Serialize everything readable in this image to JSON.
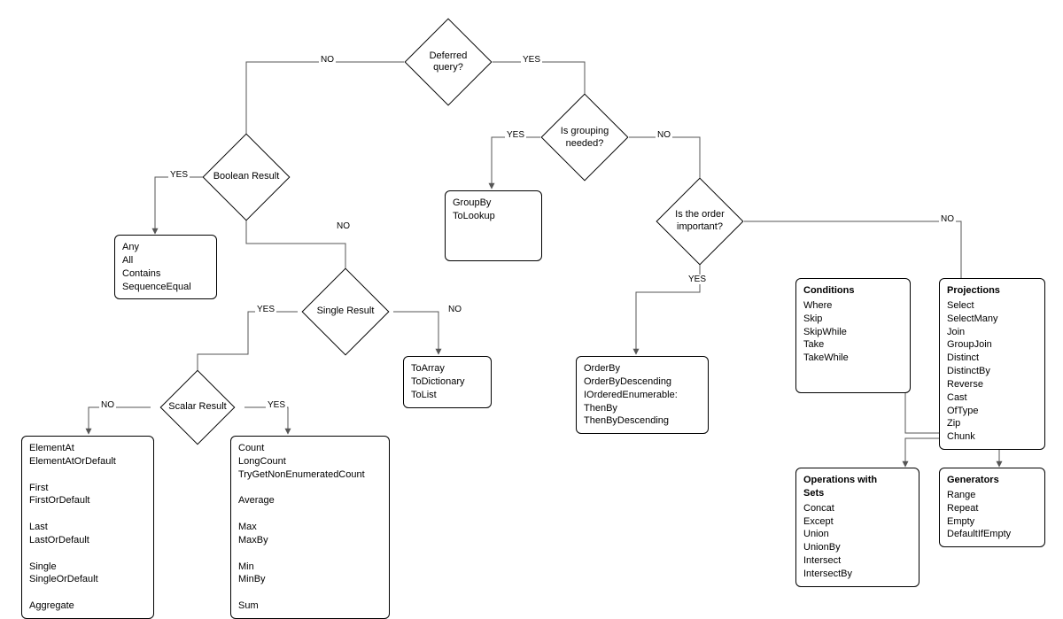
{
  "decisions": {
    "deferred": "Deferred\nquery?",
    "grouping": "Is grouping\nneeded?",
    "order": "Is the order\nimportant?",
    "boolean": "Boolean Result",
    "single": "Single Result",
    "scalar": "Scalar Result"
  },
  "labels": {
    "yes": "YES",
    "no": "NO"
  },
  "boxes": {
    "booleanOps": "Any\nAll\nContains\nSequenceEqual",
    "groupBy": "GroupBy\nToLookup",
    "toCollection": "ToArray\nToDictionary\nToList",
    "orderBy": "OrderBy\nOrderByDescending\nIOrderedEnumerable:\nThenBy\nThenByDescending",
    "conditionsTitle": "Conditions",
    "conditions": "Where\nSkip\nSkipWhile\nTake\nTakeWhile",
    "projectionsTitle": "Projections",
    "projections": "Select\nSelectMany\nJoin\nGroupJoin\nDistinct\nDistinctBy\nReverse\nCast\nOfType\nZip\nChunk",
    "setsTitle": "Operations with\nSets",
    "sets": "Concat\nExcept\nUnion\nUnionBy\nIntersect\nIntersectBy",
    "generatorsTitle": "Generators",
    "generators": "Range\nRepeat\nEmpty\nDefaultIfEmpty",
    "elementOps": "ElementAt\nElementAtOrDefault\n\nFirst\nFirstOrDefault\n\nLast\nLastOrDefault\n\nSingle\nSingleOrDefault\n\nAggregate",
    "scalarOps": "Count\nLongCount\nTryGetNonEnumeratedCount\n\nAverage\n\nMax\nMaxBy\n\nMin\nMinBy\n\nSum"
  },
  "chart_data": {
    "type": "flowchart",
    "nodes": [
      {
        "id": "deferred",
        "kind": "decision",
        "label": "Deferred query?"
      },
      {
        "id": "grouping",
        "kind": "decision",
        "label": "Is grouping needed?"
      },
      {
        "id": "order",
        "kind": "decision",
        "label": "Is the order important?"
      },
      {
        "id": "boolean",
        "kind": "decision",
        "label": "Boolean Result"
      },
      {
        "id": "single",
        "kind": "decision",
        "label": "Single Result"
      },
      {
        "id": "scalar",
        "kind": "decision",
        "label": "Scalar Result"
      },
      {
        "id": "booleanOps",
        "kind": "result",
        "items": [
          "Any",
          "All",
          "Contains",
          "SequenceEqual"
        ]
      },
      {
        "id": "groupBy",
        "kind": "result",
        "items": [
          "GroupBy",
          "ToLookup"
        ]
      },
      {
        "id": "toCollection",
        "kind": "result",
        "items": [
          "ToArray",
          "ToDictionary",
          "ToList"
        ]
      },
      {
        "id": "orderBy",
        "kind": "result",
        "items": [
          "OrderBy",
          "OrderByDescending",
          "IOrderedEnumerable:",
          "ThenBy",
          "ThenByDescending"
        ]
      },
      {
        "id": "conditions",
        "kind": "result",
        "title": "Conditions",
        "items": [
          "Where",
          "Skip",
          "SkipWhile",
          "Take",
          "TakeWhile"
        ]
      },
      {
        "id": "projections",
        "kind": "result",
        "title": "Projections",
        "items": [
          "Select",
          "SelectMany",
          "Join",
          "GroupJoin",
          "Distinct",
          "DistinctBy",
          "Reverse",
          "Cast",
          "OfType",
          "Zip",
          "Chunk"
        ]
      },
      {
        "id": "sets",
        "kind": "result",
        "title": "Operations with Sets",
        "items": [
          "Concat",
          "Except",
          "Union",
          "UnionBy",
          "Intersect",
          "IntersectBy"
        ]
      },
      {
        "id": "generators",
        "kind": "result",
        "title": "Generators",
        "items": [
          "Range",
          "Repeat",
          "Empty",
          "DefaultIfEmpty"
        ]
      },
      {
        "id": "elementOps",
        "kind": "result",
        "items": [
          "ElementAt",
          "ElementAtOrDefault",
          "",
          "First",
          "FirstOrDefault",
          "",
          "Last",
          "LastOrDefault",
          "",
          "Single",
          "SingleOrDefault",
          "",
          "Aggregate"
        ]
      },
      {
        "id": "scalarOps",
        "kind": "result",
        "items": [
          "Count",
          "LongCount",
          "TryGetNonEnumeratedCount",
          "",
          "Average",
          "",
          "Max",
          "MaxBy",
          "",
          "Min",
          "MinBy",
          "",
          "Sum"
        ]
      }
    ],
    "edges": [
      {
        "from": "deferred",
        "to": "boolean",
        "label": "NO"
      },
      {
        "from": "deferred",
        "to": "grouping",
        "label": "YES"
      },
      {
        "from": "grouping",
        "to": "groupBy",
        "label": "YES"
      },
      {
        "from": "grouping",
        "to": "order",
        "label": "NO"
      },
      {
        "from": "order",
        "to": "orderBy",
        "label": "YES"
      },
      {
        "from": "order",
        "to": "hub",
        "label": "NO"
      },
      {
        "from": "hub",
        "to": "conditions"
      },
      {
        "from": "hub",
        "to": "projections"
      },
      {
        "from": "hub",
        "to": "sets"
      },
      {
        "from": "hub",
        "to": "generators"
      },
      {
        "from": "boolean",
        "to": "booleanOps",
        "label": "YES"
      },
      {
        "from": "boolean",
        "to": "single",
        "label": "NO"
      },
      {
        "from": "single",
        "to": "scalar",
        "label": "YES"
      },
      {
        "from": "single",
        "to": "toCollection",
        "label": "NO"
      },
      {
        "from": "scalar",
        "to": "elementOps",
        "label": "NO"
      },
      {
        "from": "scalar",
        "to": "scalarOps",
        "label": "YES"
      }
    ]
  }
}
